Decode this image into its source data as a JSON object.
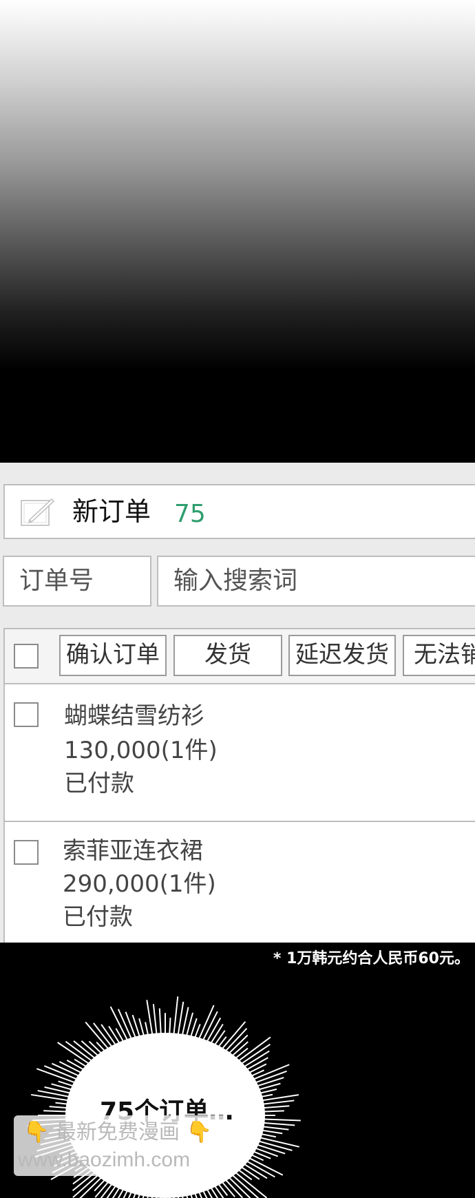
{
  "header": {
    "label": "新订单",
    "count": "75",
    "count_color": "#2f9e6e",
    "icon": "edit-icon"
  },
  "search": {
    "type_label": "订单号",
    "placeholder": "输入搜索词"
  },
  "toolbar": {
    "buttons": [
      "确认订单",
      "发货",
      "延迟发货",
      "无法销"
    ]
  },
  "orders": [
    {
      "name": "蝴蝶结雪纺衫",
      "price": "130,000(1件)",
      "status": "已付款"
    },
    {
      "name": "索菲亚连衣裙",
      "price": "290,000(1件)",
      "status": "已付款"
    }
  ],
  "footnote": "* 1万韩元约合人民币60元。",
  "speech": "75个订单…",
  "watermark": {
    "line1": "最新免费漫画",
    "line2": "www.baozimh.com",
    "icon": "pointing-hand-icon"
  }
}
